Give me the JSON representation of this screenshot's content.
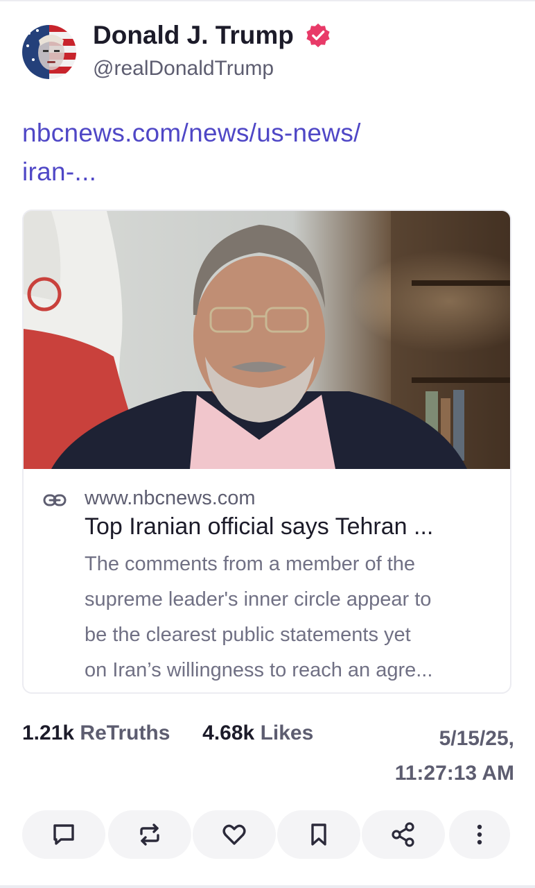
{
  "post": {
    "author": {
      "display_name": "Donald J. Trump",
      "handle": "@realDonaldTrump",
      "verified_icon": "verified-badge-icon",
      "verified_color": "#e83a68"
    },
    "link_lines": [
      "nbcnews.com/news/us-news/",
      "iran-..."
    ],
    "card": {
      "domain": "www.nbcnews.com",
      "title": "Top Iranian official says Tehran ...",
      "description_lines": [
        "The comments from a member of the",
        "supreme leader's inner circle appear to",
        "be the clearest public statements yet",
        "on Iran’s willingness to reach an agre..."
      ],
      "link_icon": "link-icon"
    },
    "stats": {
      "retruths_count": "1.21k",
      "retruths_label": "ReTruths",
      "likes_count": "4.68k",
      "likes_label": "Likes"
    },
    "timestamp_lines": [
      "5/15/25,",
      "11:27:13 AM"
    ]
  },
  "actions": [
    {
      "name": "reply",
      "icon": "comment-icon"
    },
    {
      "name": "retruth",
      "icon": "repost-icon"
    },
    {
      "name": "like",
      "icon": "heart-icon"
    },
    {
      "name": "bookmark",
      "icon": "bookmark-icon"
    },
    {
      "name": "share",
      "icon": "share-icon"
    },
    {
      "name": "more",
      "icon": "more-vertical-icon"
    }
  ],
  "colors": {
    "link": "#4f47c6",
    "text_primary": "#1c1b29",
    "text_secondary": "#5d5d70",
    "accent_verified": "#e83a68",
    "action_bg": "#f4f4f6"
  }
}
